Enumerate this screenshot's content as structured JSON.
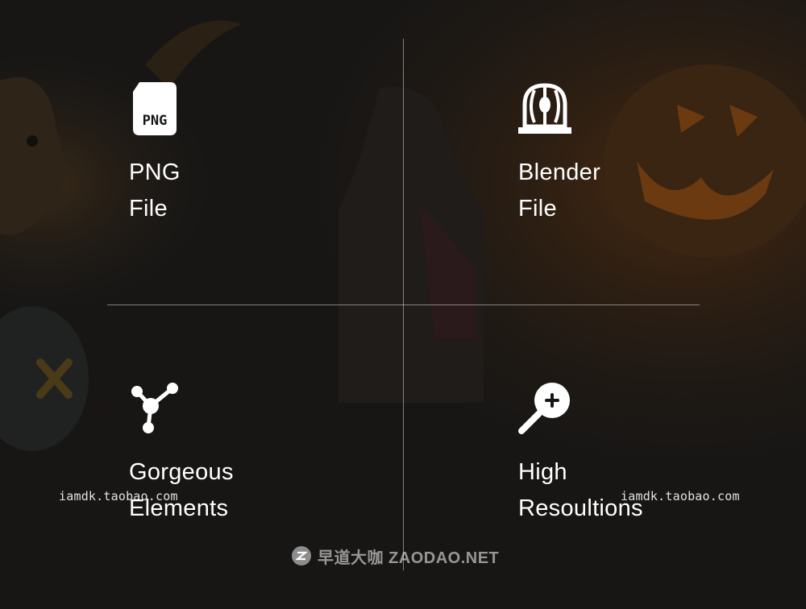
{
  "features": [
    {
      "line1": "PNG",
      "line2": "File",
      "icon": "png-file-icon",
      "icon_text": "PNG"
    },
    {
      "line1": "Blender",
      "line2": "File",
      "icon": "blender-file-icon"
    },
    {
      "line1": "Gorgeous",
      "line2": "Elements",
      "icon": "nodes-icon"
    },
    {
      "line1": "High",
      "line2": "Resoultions",
      "icon": "zoom-in-icon"
    }
  ],
  "watermarks": [
    "iamdk.taobao.com",
    "iamdk.taobao.com"
  ],
  "brand": {
    "text": "早道大咖 ZAODAO.NET"
  },
  "colors": {
    "background": "#171615",
    "text": "#ffffff",
    "accent_glow": "#6b3a10"
  }
}
